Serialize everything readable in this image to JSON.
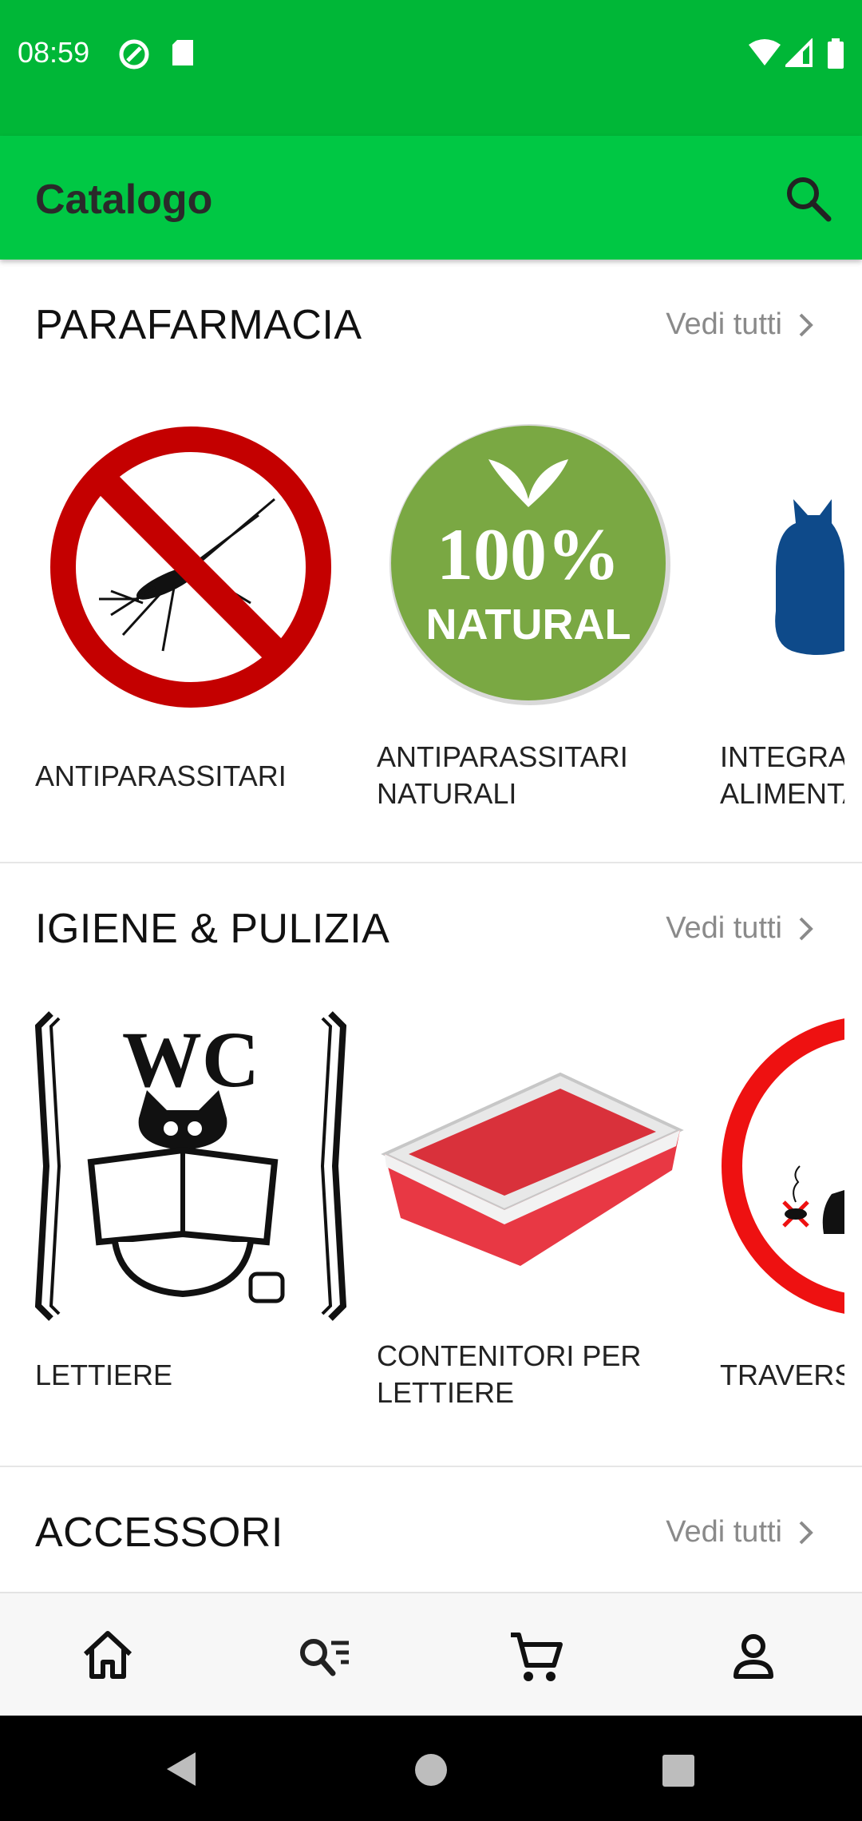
{
  "status_bar": {
    "time": "08:59"
  },
  "app_bar": {
    "title": "Catalogo"
  },
  "sections": [
    {
      "title": "PARAFARMACIA",
      "see_all": "Vedi tutti",
      "items": [
        {
          "caption": "ANTIPARASSITARI"
        },
        {
          "caption": "ANTIPARASSITARI NATURALI",
          "badge_top": "100%",
          "badge_bottom": "NATURAL"
        },
        {
          "caption": "INTEGRATORI ALIMENTARI"
        }
      ]
    },
    {
      "title": "IGIENE & PULIZIA",
      "see_all": "Vedi tutti",
      "items": [
        {
          "caption": "LETTIERE",
          "sign_text": "WC"
        },
        {
          "caption": "CONTENITORI PER LETTIERE"
        },
        {
          "caption": "TRAVERSINE"
        }
      ]
    },
    {
      "title": "ACCESSORI",
      "see_all": "Vedi tutti"
    }
  ],
  "bottom_nav": [
    "home-icon",
    "search-list-icon",
    "cart-icon",
    "account-icon"
  ],
  "colors": {
    "status_bar": "#00b737",
    "app_bar": "#00c844",
    "accent_red": "#cc0000",
    "natural_green": "#7aa843"
  }
}
